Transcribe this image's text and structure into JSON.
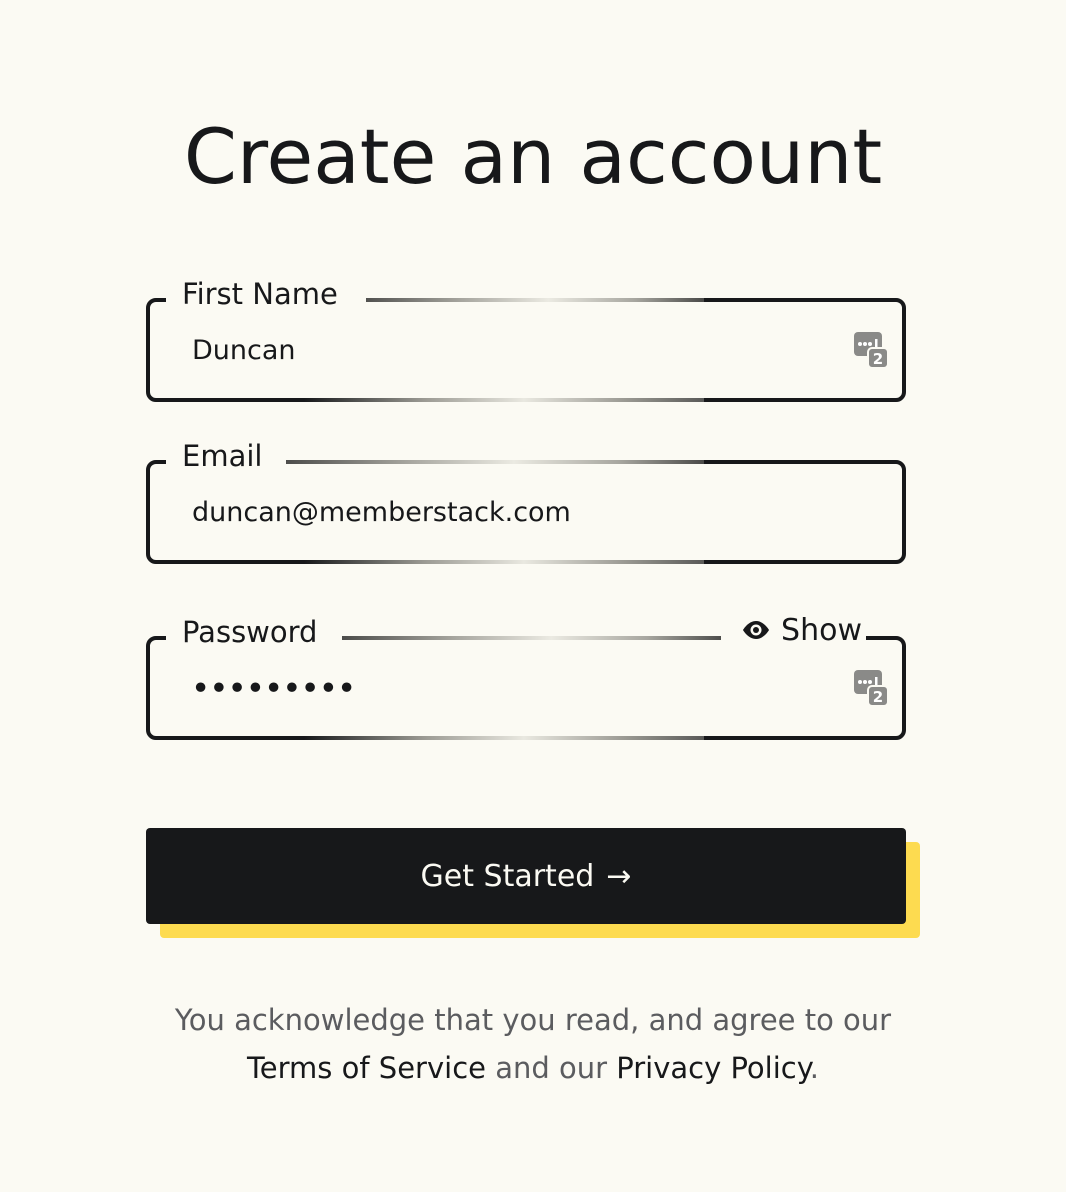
{
  "title": "Create an account",
  "fields": {
    "first_name": {
      "label": "First Name",
      "value": "Duncan",
      "icon": "password-manager-icon"
    },
    "email": {
      "label": "Email",
      "value": "duncan@memberstack.com"
    },
    "password": {
      "label": "Password",
      "value": "•••••••••",
      "toggle_label": "Show",
      "toggle_icon": "eye-icon",
      "icon": "password-manager-icon"
    }
  },
  "submit": {
    "label": "Get Started",
    "arrow": "→"
  },
  "legal": {
    "text_1": "You acknowledge that you read, and agree to our",
    "terms_link": "Terms of Service",
    "text_2": "and our",
    "privacy_link": "Privacy Policy",
    "text_3": "."
  },
  "colors": {
    "background": "#fbfaf3",
    "ink": "#17181a",
    "accent": "#fddb50",
    "muted": "#5b5c5f"
  }
}
